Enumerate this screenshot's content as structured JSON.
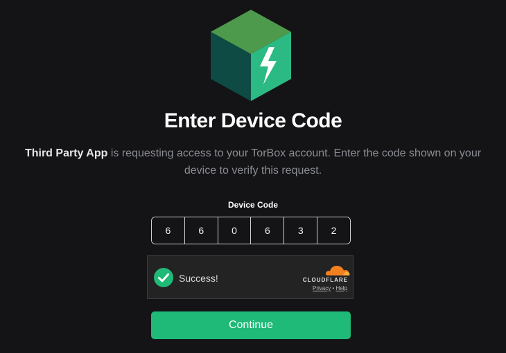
{
  "title": "Enter Device Code",
  "description": {
    "app_name": "Third Party App",
    "text": " is requesting access to your TorBox account. Enter the code shown on your device to verify this request."
  },
  "device_code": {
    "label": "Device Code",
    "digits": [
      "6",
      "6",
      "0",
      "6",
      "3",
      "2"
    ]
  },
  "captcha": {
    "status": "Success!",
    "provider": "CLOUDFLARE",
    "privacy_label": "Privacy",
    "separator": "•",
    "help_label": "Help"
  },
  "continue_label": "Continue",
  "colors": {
    "background": "#141416",
    "accent": "#1fb978",
    "logo_top": "#4e9a4c",
    "logo_left": "#0e4b44",
    "logo_right": "#2cba84",
    "cloudflare_orange": "#f48120"
  },
  "icons": {
    "logo": "torbox-cube-logo-icon",
    "check": "check-circle-icon",
    "cloudflare": "cloudflare-cloud-icon"
  }
}
